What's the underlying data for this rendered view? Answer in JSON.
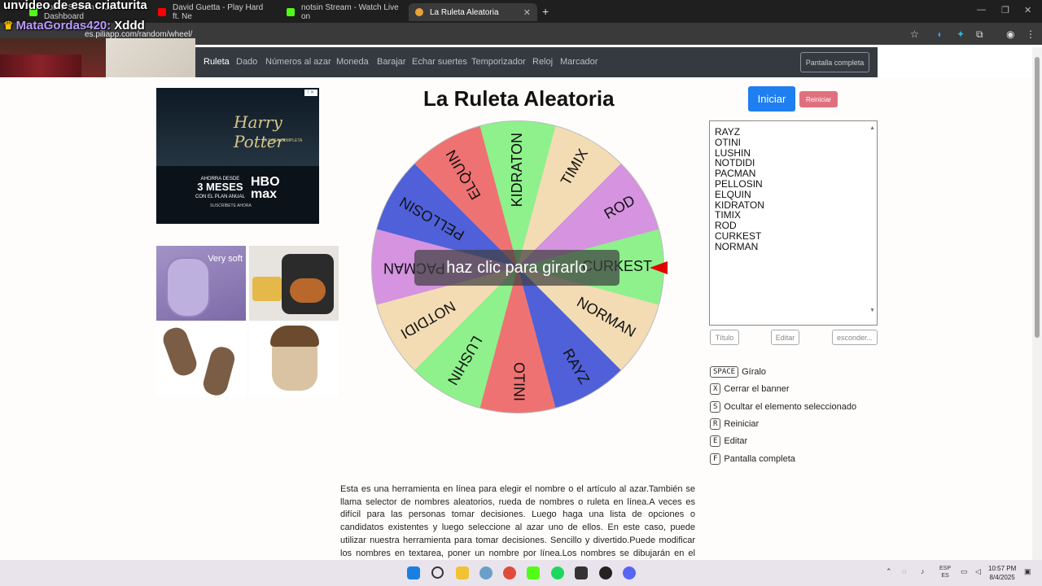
{
  "browser": {
    "tabs": [
      {
        "title": "notsin Stream - Kick Dashboard",
        "color": "#53fc18"
      },
      {
        "title": "David Guetta - Play Hard ft. Ne",
        "color": "#ff0000"
      },
      {
        "title": "notsin Stream - Watch Live on",
        "color": "#53fc18"
      },
      {
        "title": "La Ruleta Aleatoria",
        "color": "#e8a23a"
      }
    ],
    "url": "es.piliapp.com/random/wheel/"
  },
  "overlay": {
    "title": "unvideo de esa criaturita",
    "chat_user": "MataGordas420:",
    "chat_msg": "Xddd"
  },
  "nav": {
    "items": [
      "Ruleta",
      "Dado",
      "Números al azar",
      "Moneda",
      "Barajar",
      "Echar suertes",
      "Temporizador",
      "Reloj",
      "Marcador"
    ],
    "fullscreen": "Pantalla completa"
  },
  "ads": {
    "hp_title": "Harry Potter",
    "hp_sub": "LA SAGA COMPLETA",
    "hp_price_line1": "AHORRA DESDE",
    "hp_price_line2": "3 MESES",
    "hp_price_line3": "CON EL PLAN ANUAL",
    "hp_brand1": "HBO",
    "hp_brand2": "max",
    "hp_cta": "SUSCRÍBETE AHORA",
    "product_label": "Very soft"
  },
  "page": {
    "title": "La Ruleta Aleatoria",
    "spin_hint": "haz clic para girarlo",
    "start": "Iniciar",
    "reset": "Reiniciar"
  },
  "wheel": {
    "segments": [
      {
        "name": "CURKEST",
        "color": "#8ef18c"
      },
      {
        "name": "NORMAN",
        "color": "#f3dcb4"
      },
      {
        "name": "RAYZ",
        "color": "#4f60d9"
      },
      {
        "name": "OTINI",
        "color": "#ef7272"
      },
      {
        "name": "LUSHIN",
        "color": "#8ef18c"
      },
      {
        "name": "NOTDIDI",
        "color": "#f3dcb4"
      },
      {
        "name": "PACMAN",
        "color": "#d593e0"
      },
      {
        "name": "PELLOSIN",
        "color": "#4f60d9"
      },
      {
        "name": "ELQUIN",
        "color": "#ef7272"
      },
      {
        "name": "KIDRATON",
        "color": "#8ef18c"
      },
      {
        "name": "TIMIX",
        "color": "#f3dcb4"
      },
      {
        "name": "ROD",
        "color": "#d593e0"
      }
    ]
  },
  "names_list": [
    "RAYZ",
    "OTINI",
    "LUSHIN",
    "NOTDIDI",
    "PACMAN",
    "PELLOSIN",
    "ELQUIN",
    "KIDRATON",
    "TIMIX",
    "ROD",
    "CURKEST",
    "NORMAN"
  ],
  "panel_buttons": {
    "title": "Título",
    "edit": "Editar",
    "hide": "esconder..."
  },
  "shortcuts": [
    {
      "key": "SPACE",
      "label": "Gíralo"
    },
    {
      "key": "X",
      "label": "Cerrar el banner"
    },
    {
      "key": "S",
      "label": "Ocultar el elemento seleccionado"
    },
    {
      "key": "R",
      "label": "Reiniciar"
    },
    {
      "key": "E",
      "label": "Editar"
    },
    {
      "key": "F",
      "label": "Pantalla completa"
    }
  ],
  "description": "Esta es una herramienta en línea para elegir el nombre o el artículo al azar.También se llama selector de nombres aleatorios, rueda de nombres o ruleta en línea.A veces es difícil para las personas tomar decisiones. Luego haga una lista de opciones o candidatos existentes y luego seleccione al azar uno de ellos. En este caso, puede utilizar nuestra herramienta para tomar decisiones. Sencillo y divertido.Puede modificar los nombres en textarea, poner un nombre por línea.Los nombres se dibujarán en el círculo.Simplemente haga clic en la rueda",
  "taskbar": {
    "lang1": "ESP",
    "lang2": "ES",
    "time": "10:57 PM",
    "date": "8/4/2025"
  }
}
